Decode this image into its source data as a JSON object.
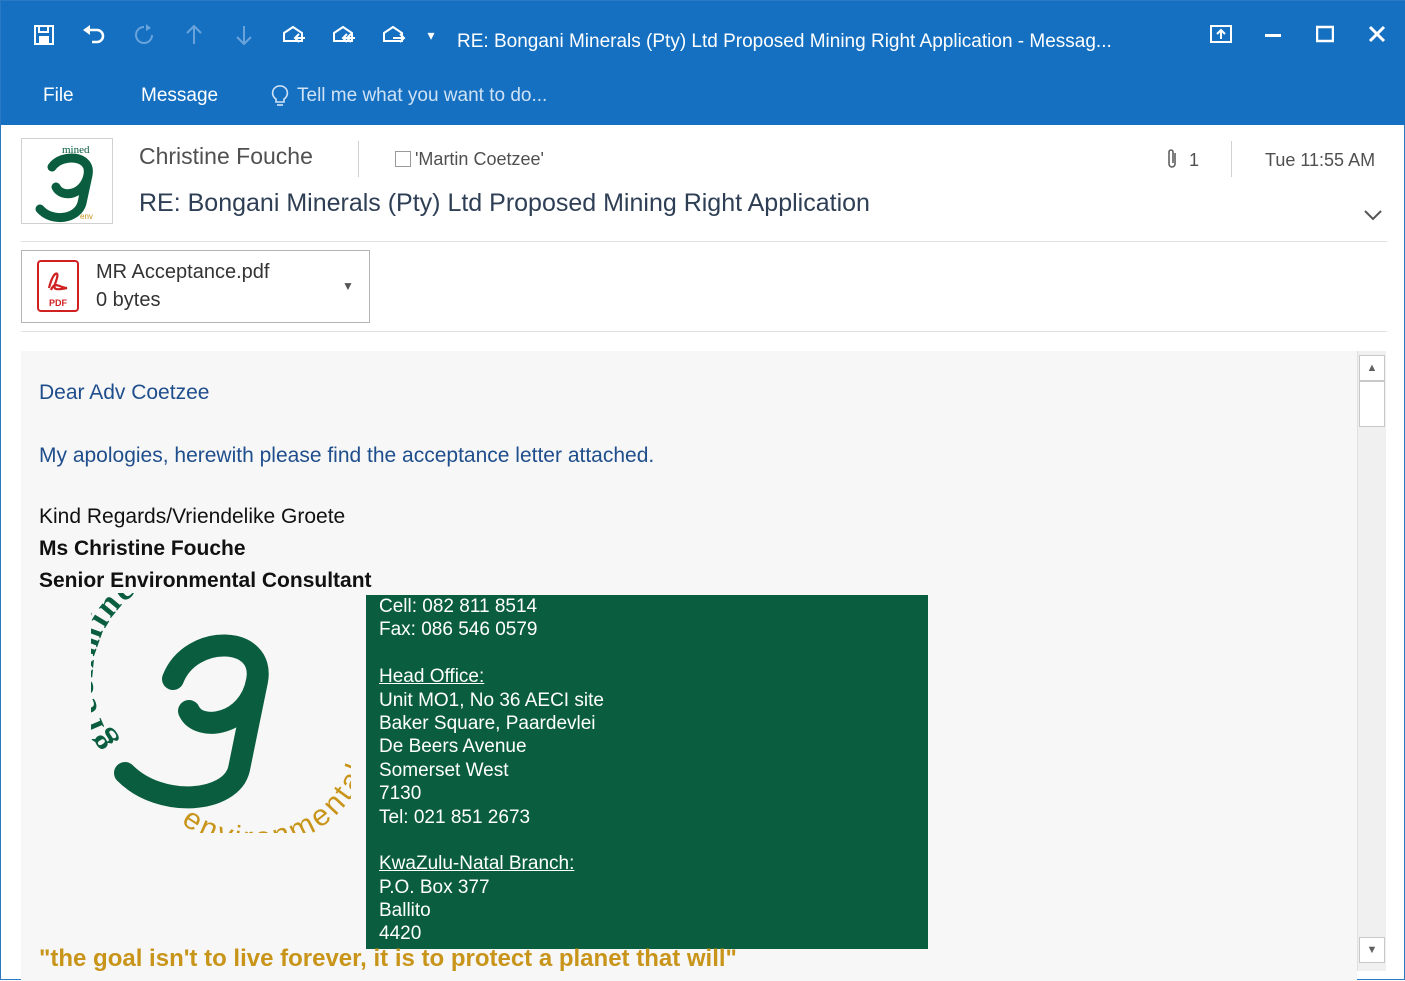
{
  "window": {
    "title": "RE: Bongani Minerals (Pty) Ltd Proposed Mining Right Application - Messag..."
  },
  "ribbon": {
    "tabs": [
      "File",
      "Message"
    ],
    "tell_me": "Tell me what you want to do..."
  },
  "header": {
    "sender": "Christine Fouche",
    "to": "'Martin Coetzee'",
    "attachment_count": "1",
    "time": "Tue 11:55 AM",
    "subject": "RE: Bongani Minerals (Pty) Ltd Proposed Mining Right Application"
  },
  "attachment": {
    "name": "MR Acceptance.pdf",
    "size": "0 bytes",
    "type_label": "PDF"
  },
  "body": {
    "greeting": "Dear Adv Coetzee",
    "message": "My apologies, herewith please find the acceptance letter attached.",
    "signoff": "Kind Regards/Vriendelike Groete",
    "name": "Ms Christine Fouche",
    "role": "Senior Environmental Consultant",
    "contact": {
      "cell": "Cell: 082 811 8514",
      "fax": "Fax: 086 546 0579",
      "head_office_title": "Head Office:",
      "head_office_lines": [
        "Unit MO1, No 36 AECI site",
        "Baker Square, Paardevlei",
        "De Beers Avenue",
        "Somerset West",
        "7130",
        "Tel: 021 851 2673"
      ],
      "branch_title": "KwaZulu-Natal Branch:",
      "branch_lines": [
        "P.O. Box 377",
        "Ballito",
        "4420"
      ]
    },
    "quote": "\"the goal isn't to live forever, it is to protect a planet that will\"",
    "logo_text": {
      "top": "greenmined",
      "bottom": "environmental",
      "letter": "g"
    }
  },
  "colors": {
    "titlebar": "#1570c1",
    "green_box": "#0a5e3f",
    "quote": "#c8951a",
    "body_blue": "#1f4e8c"
  }
}
